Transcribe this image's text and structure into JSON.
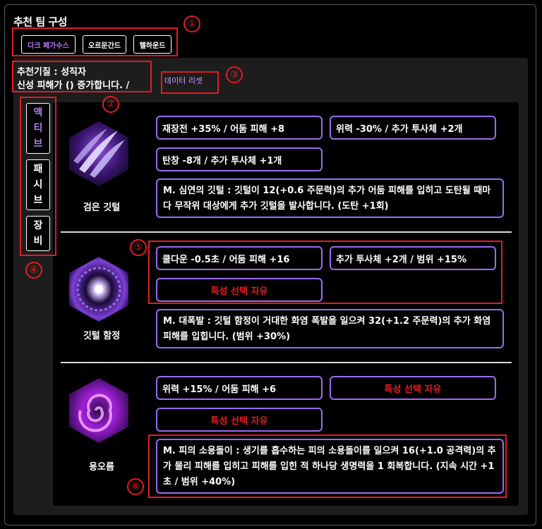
{
  "title": "추천 팀 구성",
  "tabs": [
    {
      "label": "다크 페가수스",
      "active": true
    },
    {
      "label": "오르문간드",
      "active": false
    },
    {
      "label": "헬하운드",
      "active": false
    }
  ],
  "info": {
    "line1": "추천기질 : 성직자",
    "line2": "신성 피해가 () 증가합니다. /",
    "reset_label": "데이터 리셋"
  },
  "side_tabs": [
    {
      "label": "액\n티\n브",
      "active": true
    },
    {
      "label": "패\n시\n브",
      "active": false
    },
    {
      "label": "장\n비",
      "active": false
    }
  ],
  "skills": [
    {
      "name": "검은 깃털",
      "icon": "black-feather-icon",
      "options": [
        "재장전 +35% / 어둠 피해 +8",
        "위력 -30% / 추가 투사체 +2개",
        "탄창 -8개 / 추가 투사체 +1개"
      ],
      "description": "M. 심연의 깃털 : 깃털이 12(+0.6 주문력)의 추가 어둠 피해를 입히고 도탄될 때마다 무작위 대상에게 추가 깃털을 발사합니다. (도탄 +1회)"
    },
    {
      "name": "깃털 함정",
      "icon": "feather-trap-icon",
      "options": [
        "쿨다운 -0.5초 / 어둠 피해 +16",
        "추가 투사체 +2개 / 범위 +15%",
        "특성 선택 자유"
      ],
      "description": "M. 대폭발 : 깃털 함정이 거대한 화염 폭발을 일으켜 32(+1.2 주문력)의 추가 화염 피해를 입힙니다. (범위 +30%)"
    },
    {
      "name": "용오름",
      "icon": "vortex-icon",
      "options": [
        "위력 +15% / 어둠 피해 +6",
        "특성 선택 자유",
        "특성 선택 자유"
      ],
      "description": "M. 피의 소용돌이 : 생기를 흡수하는 피의 소용돌이를 일으켜 16(+1.0 공격력)의 추가 물리 피해를 입히고 피해를 입힌 적 하나당 생명력을 1 회복합니다. (지속 시간 +1초 / 범위 +40%)"
    }
  ],
  "markers": [
    "①",
    "②",
    "③",
    "④",
    "⑤",
    "⑥"
  ],
  "colors": {
    "accent": "#9b6bf0",
    "highlight": "#e31c23",
    "tab_active": "#b07ff0"
  }
}
